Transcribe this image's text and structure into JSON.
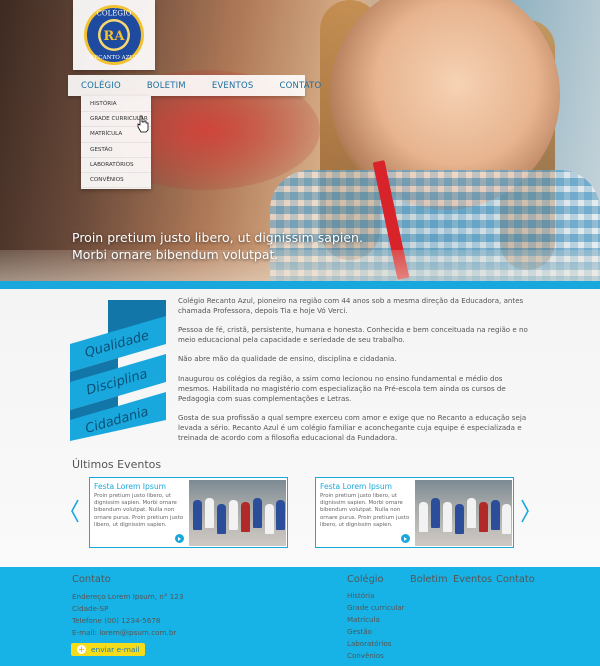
{
  "logo": {
    "text_top": "COLÉGIO",
    "text_bottom": "RECANTO AZUL",
    "monogram": "RA"
  },
  "nav": {
    "items": [
      {
        "label": "COLÉGIO"
      },
      {
        "label": "BOLETIM"
      },
      {
        "label": "EVENTOS"
      },
      {
        "label": "CONTATO"
      }
    ],
    "dropdown": [
      {
        "label": "HISTÓRIA"
      },
      {
        "label": "GRADE CURRICULAR"
      },
      {
        "label": "MATRÍCULA"
      },
      {
        "label": "GESTÃO"
      },
      {
        "label": "LABORATÓRIOS"
      },
      {
        "label": "CONVÊNIOS"
      }
    ]
  },
  "hero": {
    "line1": "Proin pretium justo libero, ut dignissim sapien.",
    "line2": "Morbi ornare bibendum volutpat."
  },
  "ribbon": {
    "word1": "Qualidade",
    "word2": "Disciplina",
    "word3": "Cidadania"
  },
  "intro": {
    "p1": "Colégio Recanto Azul, pioneiro na região com 44 anos sob a mesma direção da Educadora, antes chamada Professora, depois Tia e hoje Vó Verci.",
    "p2": "Pessoa de fé, cristã, persistente, humana e honesta. Conhecida e bem conceituada na região e no meio educacional pela capacidade e seriedade de seu trabalho.",
    "p3": "Não abre mão da qualidade de ensino, disciplina e cidadania.",
    "p4": "Inaugurou os colégios da região, a  ssim como lecionou no ensino fundamental e médio dos mesmos. Habilitada no magistério com especialização na Pré-escola tem ainda os cursos de Pedagogia com suas complementações e Letras.",
    "p5": "Gosta de sua profissão a qual sempre exerceu com amor e exige que no Recanto a educação seja levada a sério.  Recanto Azul é um colégio familiar e aconchegante cuja equipe é especializada e treinada de acordo com a filosofia educacional da Fundadora."
  },
  "events": {
    "title": "Últimos Eventos",
    "cards": [
      {
        "title": "Festa Lorem Ipsum",
        "text": "Proin pretium justo libero, ut dignissim sapien.  Morbi ornare bibendum volutpat. Nulla non ornare purus. Proin pretium justo libero, ut dignissim sapien."
      },
      {
        "title": "Festa Lorem Ipsum",
        "text": "Proin pretium justo libero, ut dignissim sapien.  Morbi ornare bibendum volutpat. Nulla non ornare purus. Proin pretium justo libero, ut dignissim sapien."
      }
    ]
  },
  "footer": {
    "contact_title": "Contato",
    "address": "Endereço Lorem Ipsum, n° 123",
    "city": "Cidade-SP",
    "phone": "Telefone (00) 1234-5678",
    "email": "E-mail: lorem@ipsum.com.br",
    "button": "enviar e-mail",
    "col_colegio": "Colégio",
    "col_boletim": "Boletim",
    "col_eventos": "Eventos",
    "col_contato": "Contato",
    "links": [
      "História",
      "Grade curricular",
      "Matrícula",
      "Gestão",
      "Laboratórios",
      "Convênios"
    ]
  },
  "colors": {
    "accent": "#19a8dd",
    "footer": "#17b3e7",
    "button": "#f5dc1a"
  }
}
